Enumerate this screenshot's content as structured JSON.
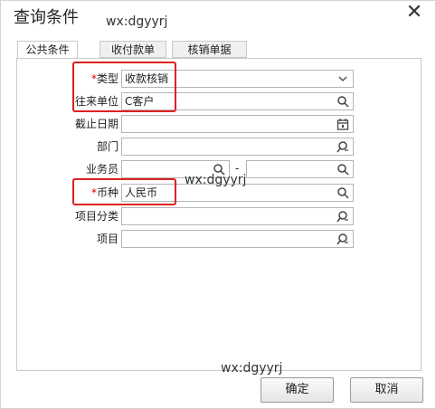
{
  "dialog": {
    "title": "查询条件",
    "close_glyph": "✕"
  },
  "watermarks": [
    "wx:dgyyrj",
    "wx:dgyyrj",
    "wx:dgyyrj"
  ],
  "tabs": [
    {
      "label": "公共条件"
    },
    {
      "label": "收付款单"
    },
    {
      "label": "核销单据"
    }
  ],
  "form": {
    "type": {
      "required": "*",
      "label": "类型",
      "value": "收款核销"
    },
    "partner": {
      "label": "往来单位",
      "value": "C客户"
    },
    "deadline": {
      "label": "截止日期",
      "value": ""
    },
    "department": {
      "label": "部门",
      "value": ""
    },
    "salesman": {
      "label": "业务员",
      "value_from": "",
      "separator": "-",
      "value_to": ""
    },
    "currency": {
      "required": "*",
      "label": "币种",
      "value": "人民币"
    },
    "project_category": {
      "label": "项目分类",
      "value": ""
    },
    "project": {
      "label": "项目",
      "value": ""
    }
  },
  "buttons": {
    "ok": "确定",
    "cancel": "取消"
  },
  "colors": {
    "highlight": "#e02020",
    "required": "#d40000",
    "border": "#b5b5b5"
  }
}
